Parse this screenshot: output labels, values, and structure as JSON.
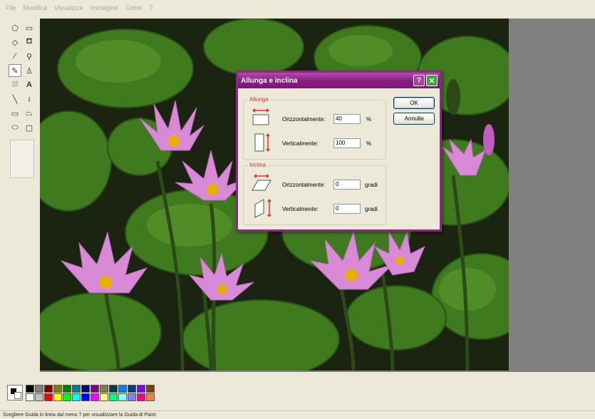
{
  "menu": [
    "File",
    "Modifica",
    "Visualizza",
    "Immagine",
    "Colori",
    "?"
  ],
  "status": {
    "text": "Scegliere Guida in linea dal menu ? per visualizzare la Guida di Paint."
  },
  "dialog": {
    "title": "Allunga e inclina",
    "stretch": {
      "label": "Allunga",
      "horizontal_label": "Orizzontalmente:",
      "horizontal_value": "40",
      "horizontal_unit": "%",
      "vertical_label": "Verticalmente:",
      "vertical_value": "100",
      "vertical_unit": "%"
    },
    "skew": {
      "label": "Inclina",
      "horizontal_label": "Orizzontalmente:",
      "horizontal_value": "0",
      "horizontal_unit": "gradi",
      "vertical_label": "Verticalmente:",
      "vertical_value": "0",
      "vertical_unit": "gradi"
    },
    "ok_label": "OK",
    "cancel_label": "Annulla"
  },
  "tools": [
    "free-select-icon",
    "rect-select-icon",
    "eraser-icon",
    "fill-bucket-icon",
    "color-picker-icon",
    "magnifier-icon",
    "pencil-icon",
    "brush-icon",
    "airbrush-icon",
    "text-icon",
    "line-icon",
    "curve-icon",
    "rectangle-icon",
    "polygon-icon",
    "ellipse-icon",
    "rounded-rect-icon"
  ],
  "palette": [
    "#000000",
    "#808080",
    "#800000",
    "#808000",
    "#008000",
    "#008080",
    "#000080",
    "#800080",
    "#808040",
    "#004040",
    "#0080ff",
    "#004080",
    "#8000ff",
    "#804000",
    "#ffffff",
    "#c0c0c0",
    "#ff0000",
    "#ffff00",
    "#00ff00",
    "#00ffff",
    "#0000ff",
    "#ff00ff",
    "#ffff80",
    "#00ff80",
    "#80ffff",
    "#8080ff",
    "#ff0080",
    "#ff8040"
  ]
}
